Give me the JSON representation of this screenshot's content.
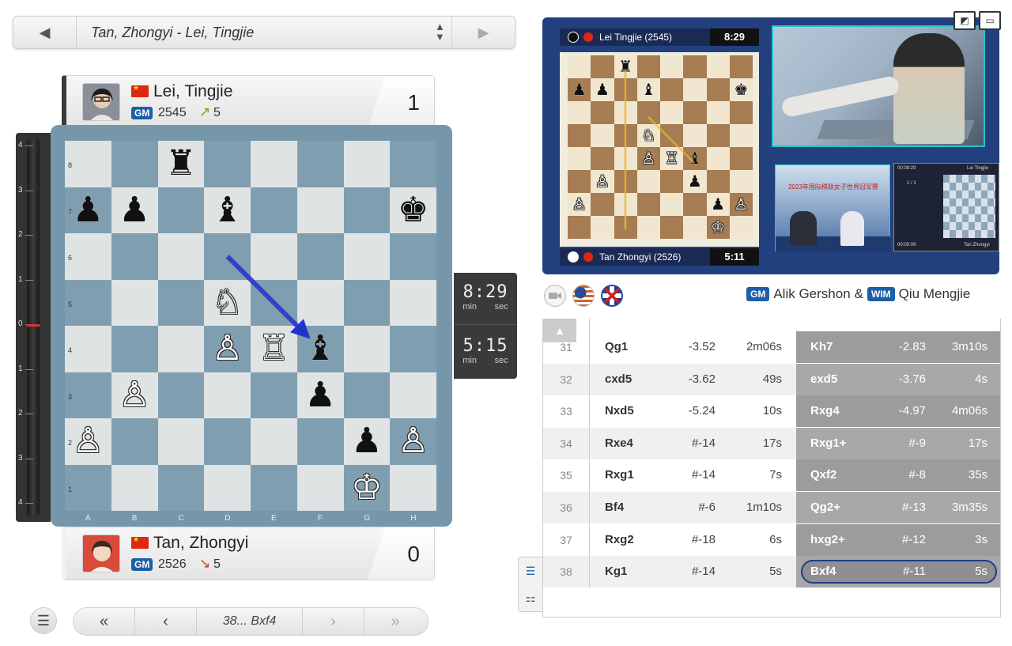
{
  "game_selector": {
    "title": "Tan, Zhongyi - Lei, Tingjie",
    "prev_icon": "◀",
    "next_icon": "▶",
    "updown_icon_up": "▲",
    "updown_icon_down": "▼"
  },
  "player_top": {
    "name": "Lei, Tingjie",
    "title": "GM",
    "rating": "2545",
    "rating_change": "5",
    "trend_arrow": "↗",
    "trend_color": "#5fb030",
    "score": "1"
  },
  "player_bottom": {
    "name": "Tan, Zhongyi",
    "title": "GM",
    "rating": "2526",
    "rating_change": "5",
    "trend_arrow": "↘",
    "trend_color": "#d0402a",
    "score": "0"
  },
  "eval_bar": {
    "labels": [
      "4",
      "3",
      "2",
      "1",
      "0",
      "1",
      "2",
      "3",
      "4"
    ]
  },
  "board": {
    "files": [
      "A",
      "B",
      "C",
      "D",
      "E",
      "F",
      "G",
      "H"
    ],
    "ranks": [
      "8",
      "7",
      "6",
      "5",
      "4",
      "3",
      "2",
      "1"
    ],
    "position": [
      [
        "",
        "",
        "♜",
        "",
        "",
        "",
        "",
        ""
      ],
      [
        "♟",
        "♟",
        "",
        "♝",
        "",
        "",
        "",
        "♚"
      ],
      [
        "",
        "",
        "",
        "",
        "",
        "",
        "",
        ""
      ],
      [
        "",
        "",
        "",
        "♘",
        "",
        "",
        "",
        ""
      ],
      [
        "",
        "",
        "",
        "♙",
        "♖",
        "♝",
        "",
        ""
      ],
      [
        "",
        "♙",
        "",
        "",
        "",
        "♟",
        "",
        ""
      ],
      [
        "♙",
        "",
        "",
        "",
        "",
        "",
        "♟",
        "♙"
      ],
      [
        "",
        "",
        "",
        "",
        "",
        "",
        "♔",
        ""
      ]
    ],
    "colors": [
      [
        "",
        "",
        "b",
        "",
        "",
        "",
        "",
        ""
      ],
      [
        "b",
        "b",
        "",
        "b",
        "",
        "",
        "",
        "b"
      ],
      [
        "",
        "",
        "",
        "",
        "",
        "",
        "",
        ""
      ],
      [
        "",
        "",
        "",
        "w",
        "",
        "",
        "",
        ""
      ],
      [
        "",
        "",
        "",
        "w",
        "w",
        "b",
        "",
        ""
      ],
      [
        "",
        "w",
        "",
        "",
        "",
        "b",
        "",
        ""
      ],
      [
        "w",
        "",
        "",
        "",
        "",
        "",
        "b",
        "w"
      ],
      [
        "",
        "",
        "",
        "",
        "",
        "",
        "w",
        ""
      ]
    ],
    "last_move": {
      "from": "d6",
      "to": "f4"
    },
    "arrow_color": "#2233cc"
  },
  "clocks": {
    "top": {
      "time": "8:29",
      "min_label": "min",
      "sec_label": "sec"
    },
    "bottom": {
      "time": "5:15",
      "min_label": "min",
      "sec_label": "sec"
    }
  },
  "nav": {
    "menu_icon": "☰",
    "first_icon": "«",
    "prev_icon": "‹",
    "current_move": "38... Bxf4",
    "next_icon": "›",
    "last_icon": "»"
  },
  "video": {
    "top_bar": {
      "name": "Lei Tingjie (2545)",
      "time": "8:29"
    },
    "bottom_bar": {
      "name": "Tan Zhongyi (2526)",
      "time": "5:11"
    },
    "position": [
      [
        "",
        "",
        "♜",
        "",
        "",
        "",
        "",
        ""
      ],
      [
        "♟",
        "♟",
        "",
        "♝",
        "",
        "",
        "",
        "♚"
      ],
      [
        "",
        "",
        "",
        "",
        "",
        "",
        "",
        ""
      ],
      [
        "",
        "",
        "",
        "♘",
        "",
        "",
        "",
        ""
      ],
      [
        "",
        "",
        "",
        "♙",
        "♖",
        "♝",
        "",
        ""
      ],
      [
        "",
        "♙",
        "",
        "",
        "",
        "♟",
        "",
        ""
      ],
      [
        "♙",
        "",
        "",
        "",
        "",
        "",
        "♟",
        "♙"
      ],
      [
        "",
        "",
        "",
        "",
        "",
        "",
        "♔",
        ""
      ]
    ],
    "mini_clock_top": "00:08:29",
    "mini_clock_bottom": "00:05:09",
    "mini_name_top": "Lei Tingjie",
    "mini_name_bottom": "Tan Zhongyi",
    "mini_game_num": "1 / 1",
    "small_banner": "2023年国际棋联女子世界冠军赛",
    "corner_icon_1": "◩",
    "corner_icon_2": "▭"
  },
  "commentary": {
    "title1": "GM",
    "name1": "Alik Gershon",
    "sep": "&",
    "title2": "WIM",
    "name2": "Qiu Mengjie"
  },
  "moves": [
    {
      "num": "31",
      "w": "Qg1",
      "we": "-3.52",
      "wt": "2m06s",
      "b": "Kh7",
      "be": "-2.83",
      "bt": "3m10s"
    },
    {
      "num": "32",
      "w": "cxd5",
      "we": "-3.62",
      "wt": "49s",
      "b": "exd5",
      "be": "-3.76",
      "bt": "4s"
    },
    {
      "num": "33",
      "w": "Nxd5",
      "we": "-5.24",
      "wt": "10s",
      "b": "Rxg4",
      "be": "-4.97",
      "bt": "4m06s"
    },
    {
      "num": "34",
      "w": "Rxe4",
      "we": "#-14",
      "wt": "17s",
      "b": "Rxg1+",
      "be": "#-9",
      "bt": "17s"
    },
    {
      "num": "35",
      "w": "Rxg1",
      "we": "#-14",
      "wt": "7s",
      "b": "Qxf2",
      "be": "#-8",
      "bt": "35s"
    },
    {
      "num": "36",
      "w": "Bf4",
      "we": "#-6",
      "wt": "1m10s",
      "b": "Qg2+",
      "be": "#-13",
      "bt": "3m35s"
    },
    {
      "num": "37",
      "w": "Rxg2",
      "we": "#-18",
      "wt": "6s",
      "b": "hxg2+",
      "be": "#-12",
      "bt": "3s"
    },
    {
      "num": "38",
      "w": "Kg1",
      "we": "#-14",
      "wt": "5s",
      "b": "Bxf4",
      "be": "#-11",
      "bt": "5s"
    }
  ],
  "side_tools": {
    "list_icon": "☰",
    "chat_icon": "⚏"
  },
  "scroll_up_icon": "▲"
}
